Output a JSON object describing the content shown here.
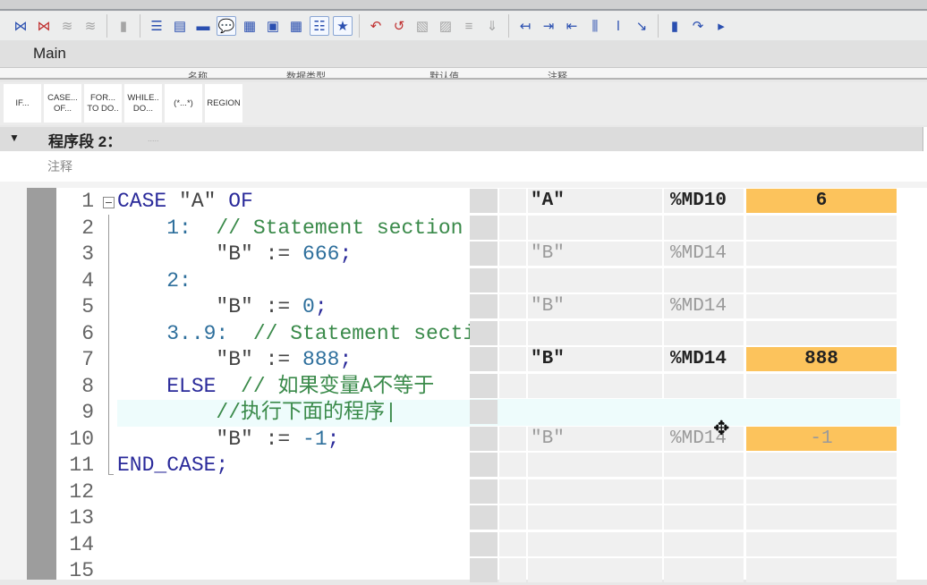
{
  "toolbar": {
    "icons": [
      "insert-block-call-icon",
      "delete-block-call-icon",
      "update-icon",
      "update-all-icon",
      "db-icon",
      "list-icon",
      "view-split-icon",
      "view-collapse-icon",
      "comment-bubble-icon",
      "tag-down-icon",
      "user-down-icon",
      "tag2-down-icon",
      "indent-list-icon",
      "favorite-icon",
      "breakpoint-clear-icon",
      "goto-clear-icon",
      "copy-icon",
      "paste-icon",
      "align-icon",
      "download-icon",
      "jump-left-icon",
      "indent-right-icon",
      "indent-left-icon",
      "columns-icon",
      "insert-line-icon",
      "delete-line-icon",
      "bookmark-add-icon",
      "bookmark-goto-icon",
      "more-icon"
    ]
  },
  "block": {
    "name": "Main"
  },
  "interface_header": {
    "columns": [
      "名称",
      "数据类型",
      "默认值",
      "注释"
    ]
  },
  "instructions": [
    {
      "label": "IF..."
    },
    {
      "label": "CASE...\nOF..."
    },
    {
      "label": "FOR...\nTO DO.."
    },
    {
      "label": "WHILE..\nDO..."
    },
    {
      "label": "(*...*)"
    },
    {
      "label": "REGION"
    }
  ],
  "network": {
    "title": "程序段 2：",
    "dots": ".....",
    "comment_placeholder": "注释"
  },
  "code": [
    {
      "n": "1",
      "parts": [
        [
          "kw",
          "CASE "
        ],
        [
          "str",
          "\"A\" "
        ],
        [
          "kw",
          "OF"
        ]
      ]
    },
    {
      "n": "2",
      "parts": [
        [
          "num",
          "    1:  "
        ],
        [
          "cm",
          "// Statement section"
        ]
      ]
    },
    {
      "n": "3",
      "parts": [
        [
          "str",
          "        \"B\" := "
        ],
        [
          "num",
          "666"
        ],
        [
          "kw",
          ";"
        ]
      ]
    },
    {
      "n": "4",
      "parts": [
        [
          "num",
          "    2:"
        ]
      ]
    },
    {
      "n": "5",
      "parts": [
        [
          "str",
          "        \"B\" := "
        ],
        [
          "num",
          "0"
        ],
        [
          "kw",
          ";"
        ]
      ]
    },
    {
      "n": "6",
      "parts": [
        [
          "num",
          "    3..9:  "
        ],
        [
          "cm",
          "// Statement section"
        ]
      ]
    },
    {
      "n": "7",
      "parts": [
        [
          "str",
          "        \"B\" := "
        ],
        [
          "num",
          "888"
        ],
        [
          "kw",
          ";"
        ]
      ]
    },
    {
      "n": "8",
      "parts": [
        [
          "kw",
          "    ELSE  "
        ],
        [
          "cm",
          "// 如果变量A不等于"
        ]
      ]
    },
    {
      "n": "9",
      "parts": [
        [
          "cm",
          "        //执行下面的程序|"
        ]
      ]
    },
    {
      "n": "10",
      "parts": [
        [
          "str",
          "        \"B\" := "
        ],
        [
          "num",
          "-1"
        ],
        [
          "kw",
          ";"
        ]
      ]
    },
    {
      "n": "11",
      "parts": [
        [
          "kw",
          "END_CASE;"
        ]
      ]
    },
    {
      "n": "12",
      "parts": []
    },
    {
      "n": "13",
      "parts": []
    },
    {
      "n": "14",
      "parts": []
    },
    {
      "n": "15",
      "parts": []
    }
  ],
  "monitor": [
    {
      "name": "\"A\"",
      "addr": "%MD10",
      "value": "6",
      "active": true
    },
    {},
    {
      "name": "\"B\"",
      "addr": "%MD14",
      "value": "",
      "active": false
    },
    {},
    {
      "name": "\"B\"",
      "addr": "%MD14",
      "value": "",
      "active": false
    },
    {},
    {
      "name": "\"B\"",
      "addr": "%MD14",
      "value": "888",
      "active": true
    },
    {},
    {},
    {
      "name": "\"B\"",
      "addr": "%MD14",
      "value": "-1",
      "active": false
    },
    {},
    {},
    {},
    {},
    {}
  ],
  "colors": {
    "monitor_value_bg": "#fcc35c",
    "current_line_bg": "#eefcfc",
    "keyword": "#2a2a9a",
    "comment": "#3a8a4a",
    "number": "#2e6f9c"
  }
}
